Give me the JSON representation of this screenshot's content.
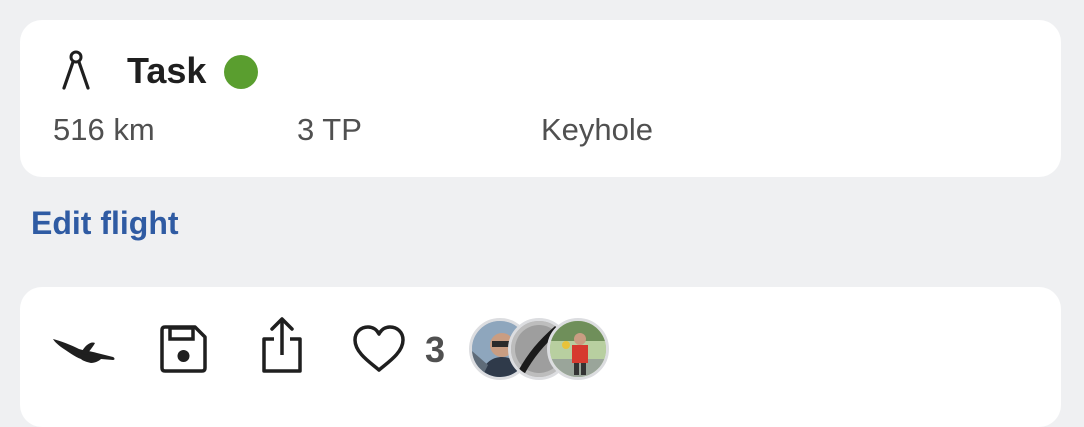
{
  "task": {
    "title": "Task",
    "status_color": "#5a9e2f",
    "distance": "516 km",
    "turnpoints": "3 TP",
    "sector_type": "Keyhole",
    "icon": "compass-icon"
  },
  "edit_flight": {
    "label": "Edit flight"
  },
  "actions": {
    "bird_icon": "bird-icon",
    "save_icon": "save-icon",
    "share_icon": "share-icon",
    "like_icon": "heart-icon",
    "like_count": "3",
    "likers": [
      "avatar-pilot-cockpit",
      "avatar-glider-wing",
      "avatar-person-red-shirt"
    ]
  },
  "colors": {
    "background": "#eff0f2",
    "card": "#ffffff",
    "link": "#2f5ba3",
    "text_primary": "#1f1f1f",
    "text_secondary": "#505050"
  }
}
